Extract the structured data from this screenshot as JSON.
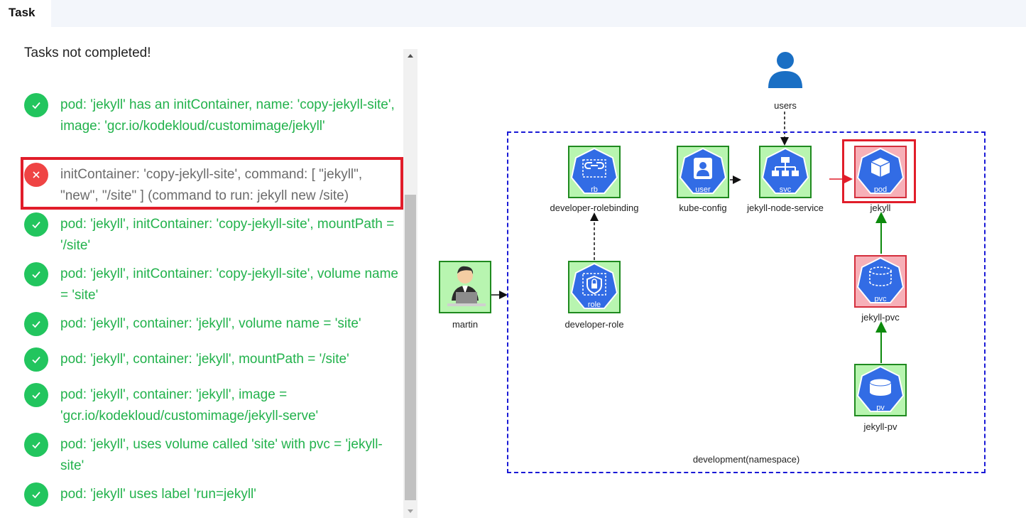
{
  "tab": {
    "label": "Task"
  },
  "panel": {
    "title": "Tasks not completed!"
  },
  "tasks": [
    {
      "status": "ok",
      "text": "pod: 'jekyll' has an initContainer, name: 'copy-jekyll-site', image: 'gcr.io/kodekloud/customimage/jekyll'"
    },
    {
      "status": "fail",
      "text": "initContainer: 'copy-jekyll-site', command: [ \"jekyll\", \"new\", \"/site\" ] (command to run: jekyll new /site)"
    },
    {
      "status": "ok",
      "text": "pod: 'jekyll', initContainer: 'copy-jekyll-site', mountPath = '/site'"
    },
    {
      "status": "ok",
      "text": "pod: 'jekyll', initContainer: 'copy-jekyll-site', volume name = 'site'"
    },
    {
      "status": "ok",
      "text": "pod: 'jekyll', container: 'jekyll', volume name = 'site'"
    },
    {
      "status": "ok",
      "text": "pod: 'jekyll', container: 'jekyll', mountPath = '/site'"
    },
    {
      "status": "ok",
      "text": "pod: 'jekyll', container: 'jekyll', image = 'gcr.io/kodekloud/customimage/jekyll-serve'"
    },
    {
      "status": "ok",
      "text": "pod: 'jekyll', uses volume called 'site' with pvc = 'jekyll-site'"
    },
    {
      "status": "ok",
      "text": "pod: 'jekyll' uses label 'run=jekyll'"
    }
  ],
  "diagram": {
    "users_label": "users",
    "namespace_label": "development(namespace)",
    "nodes": {
      "martin": {
        "label": "martin"
      },
      "rolebinding": {
        "code": "rb",
        "label": "developer-rolebinding"
      },
      "role": {
        "code": "role",
        "label": "developer-role"
      },
      "kubeconfig": {
        "code": "user",
        "label": "kube-config"
      },
      "service": {
        "code": "svc",
        "label": "jekyll-node-service"
      },
      "pod": {
        "code": "pod",
        "label": "jekyll",
        "state": "error"
      },
      "pvc": {
        "code": "pvc",
        "label": "jekyll-pvc",
        "state": "error"
      },
      "pv": {
        "code": "pv",
        "label": "jekyll-pv"
      }
    }
  },
  "colors": {
    "ok": "#22c55e",
    "fail": "#ef4444",
    "ok_text": "#22b24c",
    "k8s_blue": "#326ce5",
    "node_ok_bg": "#b8f5b0",
    "node_err_bg": "#f7b0b8",
    "namespace_border": "#1a1ad6"
  }
}
